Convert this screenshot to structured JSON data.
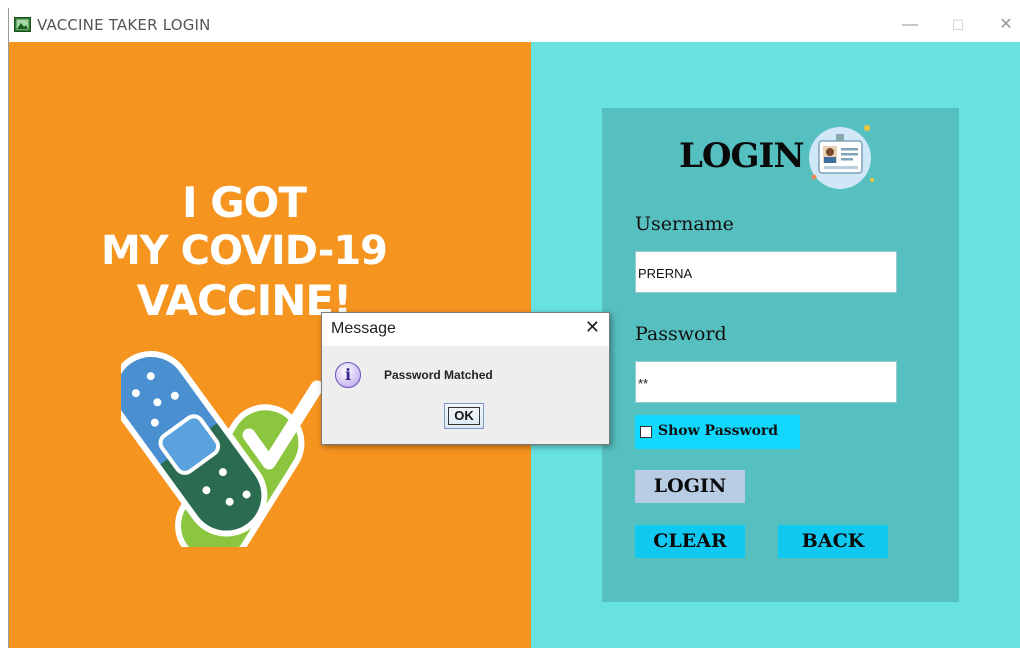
{
  "window": {
    "title": "VACCINE TAKER LOGIN",
    "controls": {
      "minimize": "—",
      "maximize": "☐",
      "close": "✕"
    }
  },
  "poster": {
    "line1": "I GOT",
    "line2": "MY COVID-19",
    "line3": "VACCINE!",
    "colors": {
      "background": "#f5941f",
      "bandage_blue": "#4a90d0",
      "bandage_green": "#2b6b50",
      "check_green": "#8cc63f"
    }
  },
  "login_form": {
    "heading": "LOGIN",
    "username_label": "Username",
    "username_value": "PRERNA",
    "password_label": "Password",
    "password_value": "**",
    "show_password_label": "Show Password",
    "show_password_checked": false,
    "login_button": "LOGIN",
    "clear_button": "CLEAR",
    "back_button": "BACK",
    "colors": {
      "panel_bg": "#67e2e0",
      "form_bg": "#56bfbf",
      "login_btn": "#b8cde4",
      "action_btn": "#10c8f0"
    }
  },
  "dialog": {
    "title": "Message",
    "close": "✕",
    "icon": "info-icon",
    "icon_glyph": "i",
    "message": "Password Matched",
    "ok_button": "OK"
  }
}
